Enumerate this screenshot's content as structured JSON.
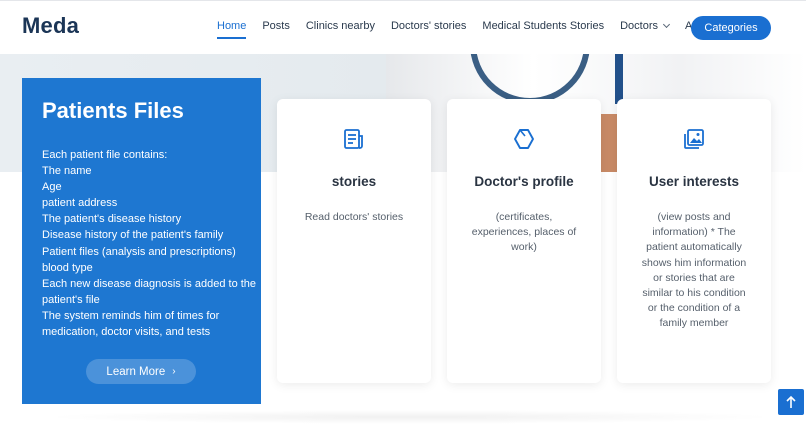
{
  "header": {
    "logo": "Meda",
    "nav": [
      {
        "label": "Home",
        "active": true
      },
      {
        "label": "Posts"
      },
      {
        "label": "Clinics nearby"
      },
      {
        "label": "Doctors' stories"
      },
      {
        "label": "Medical Students Stories"
      },
      {
        "label": "Doctors",
        "dropdown": true
      },
      {
        "label": "About"
      }
    ],
    "cta": "Categories"
  },
  "panel": {
    "title": "Patients Files",
    "lines": [
      "Each patient file contains:",
      "The name",
      "Age",
      "patient address",
      "The patient's disease history",
      "Disease history of the patient's family",
      "Patient files (analysis and prescriptions)",
      "blood type",
      "Each new disease diagnosis is added to the patient's file",
      "The system reminds him of times for medication, doctor visits, and tests"
    ],
    "button": "Learn More",
    "button_icon": "chevron-right-icon"
  },
  "cards": [
    {
      "title": "stories",
      "text": "Read doctors' stories",
      "icon": "newspaper-icon"
    },
    {
      "title": "Doctor's profile",
      "text": "(certificates, experiences, places of work)",
      "icon": "hexagon-icon"
    },
    {
      "title": "User interests",
      "text": "(view posts and information) * The patient automatically shows him information or stories that are similar to his condition or the condition of a family member",
      "icon": "images-icon"
    }
  ],
  "scroll_top_icon": "arrow-up-icon",
  "colors": {
    "accent": "#1a6fd1",
    "panel": "#1e77d1",
    "logo": "#1b3556"
  }
}
